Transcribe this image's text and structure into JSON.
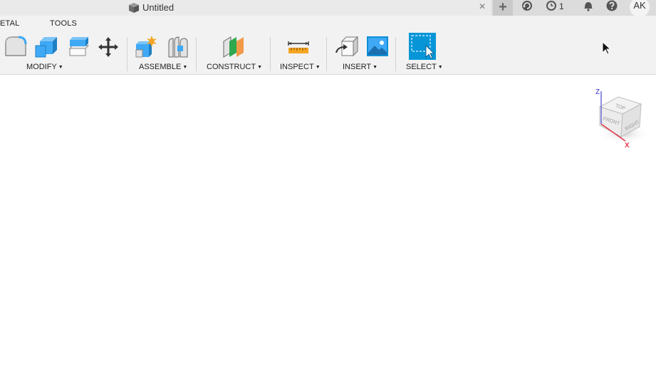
{
  "titlebar": {
    "doc_title": "Untitled",
    "close_glyph": "×",
    "new_tab_glyph": "+",
    "jobs_count": "1",
    "avatar_initials": "AK",
    "icons": [
      "box-icon",
      "close-icon",
      "plus-icon",
      "recover-icon",
      "clock-icon",
      "bell-icon",
      "help-icon"
    ]
  },
  "ribbon": {
    "tabs": [
      {
        "label": "ETAL"
      },
      {
        "label": "TOOLS"
      }
    ],
    "groups": [
      {
        "label": "MODIFY",
        "tools": [
          "fillet-icon",
          "shell-icon",
          "combine-icon",
          "move-icon"
        ]
      },
      {
        "label": "ASSEMBLE",
        "tools": [
          "new-component-icon",
          "joint-icon"
        ]
      },
      {
        "label": "CONSTRUCT",
        "tools": [
          "offset-plane-icon"
        ]
      },
      {
        "label": "INSPECT",
        "tools": [
          "measure-icon"
        ]
      },
      {
        "label": "INSERT",
        "tools": [
          "insert-derive-icon",
          "insert-image-icon"
        ]
      },
      {
        "label": "SELECT",
        "tools": [
          "select-icon"
        ]
      }
    ],
    "caret_glyph": "▼"
  },
  "viewcube": {
    "top_label": "TOP",
    "front_label": "FRONT",
    "right_label": "RIGHT",
    "axis_z": "Z",
    "axis_x": "X"
  },
  "colors": {
    "titlebar_bg": "#eaeaea",
    "ribbon_bg": "#f2f2f2",
    "accent_blue": "#0696d7",
    "tool_blue": "#3fa9f5",
    "construct_green": "#2fa84f",
    "construct_orange": "#f29a4a",
    "inspect_orange": "#f5a623",
    "axis_z": "#6b6bd6",
    "axis_x": "#e0394a"
  }
}
